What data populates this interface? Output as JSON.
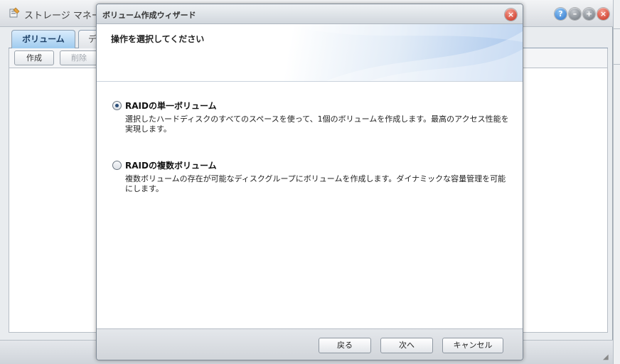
{
  "background_app": {
    "title": "ストレージ マネージ",
    "tabs": [
      {
        "label": "ボリューム"
      },
      {
        "label": "デ"
      }
    ],
    "toolbar": {
      "create_label": "作成",
      "delete_label": "削除"
    }
  },
  "dialog": {
    "title": "ボリューム作成ウィザード",
    "close_glyph": "×",
    "header_title": "操作を選択してください",
    "options": [
      {
        "label": "RAIDの単一ボリューム",
        "description": "選択したハードディスクのすべてのスペースを使って、1個のボリュームを作成します。最高のアクセス性能を実現します。",
        "selected": true
      },
      {
        "label": "RAIDの複数ボリューム",
        "description": "複数ボリュームの存在が可能なディスクグループにボリュームを作成します。ダイナミックな容量管理を可能にします。",
        "selected": false
      }
    ],
    "buttons": {
      "back": "戻る",
      "next": "次へ",
      "cancel": "キャンセル"
    }
  },
  "window_controls": {
    "help_glyph": "?",
    "minimize_glyph": "–",
    "maximize_glyph": "+",
    "close_glyph": "×"
  },
  "colors": {
    "tab_active": "#9fcbef",
    "close_red": "#c72e1c",
    "header_blue": "#a8c6ec"
  }
}
